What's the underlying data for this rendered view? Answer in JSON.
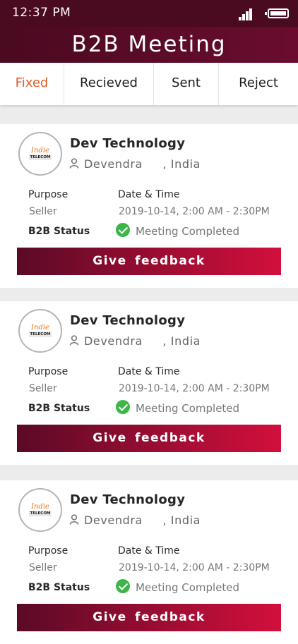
{
  "status_bar": {
    "time": "12:37 PM",
    "signal_icon": "signal-icon",
    "battery_icon": "battery-icon"
  },
  "header": {
    "title": "B2B Meeting"
  },
  "tabs": [
    {
      "label": "Fixed",
      "active": true
    },
    {
      "label": "Recieved",
      "active": false
    },
    {
      "label": "Sent",
      "active": false
    },
    {
      "label": "Reject",
      "active": false
    }
  ],
  "colors": {
    "accent_tab": "#e25b26",
    "header": "#4a0a20",
    "button_start": "#5a0a26",
    "button_end": "#d30f3c",
    "status_check": "#3db548"
  },
  "labels": {
    "purpose": "Purpose",
    "date_time": "Date & Time",
    "b2b_status": "B2B Status",
    "give_feedback": "Give  feedback"
  },
  "meetings": [
    {
      "logo_line1": "Indie",
      "logo_line2": "TELECOM",
      "company": "Dev Technology",
      "person": "Devendra",
      "location": ", India",
      "purpose": "Seller",
      "datetime": "2019-10-14, 2:00 AM - 2:30PM",
      "status": "Meeting Completed"
    },
    {
      "logo_line1": "Indie",
      "logo_line2": "TELECOM",
      "company": "Dev Technology",
      "person": "Devendra",
      "location": ", India",
      "purpose": "Seller",
      "datetime": "2019-10-14, 2:00 AM - 2:30PM",
      "status": "Meeting Completed"
    },
    {
      "logo_line1": "Indie",
      "logo_line2": "TELECOM",
      "company": "Dev Technology",
      "person": "Devendra",
      "location": ", India",
      "purpose": "Seller",
      "datetime": "2019-10-14, 2:00 AM - 2:30PM",
      "status": "Meeting Completed"
    }
  ]
}
